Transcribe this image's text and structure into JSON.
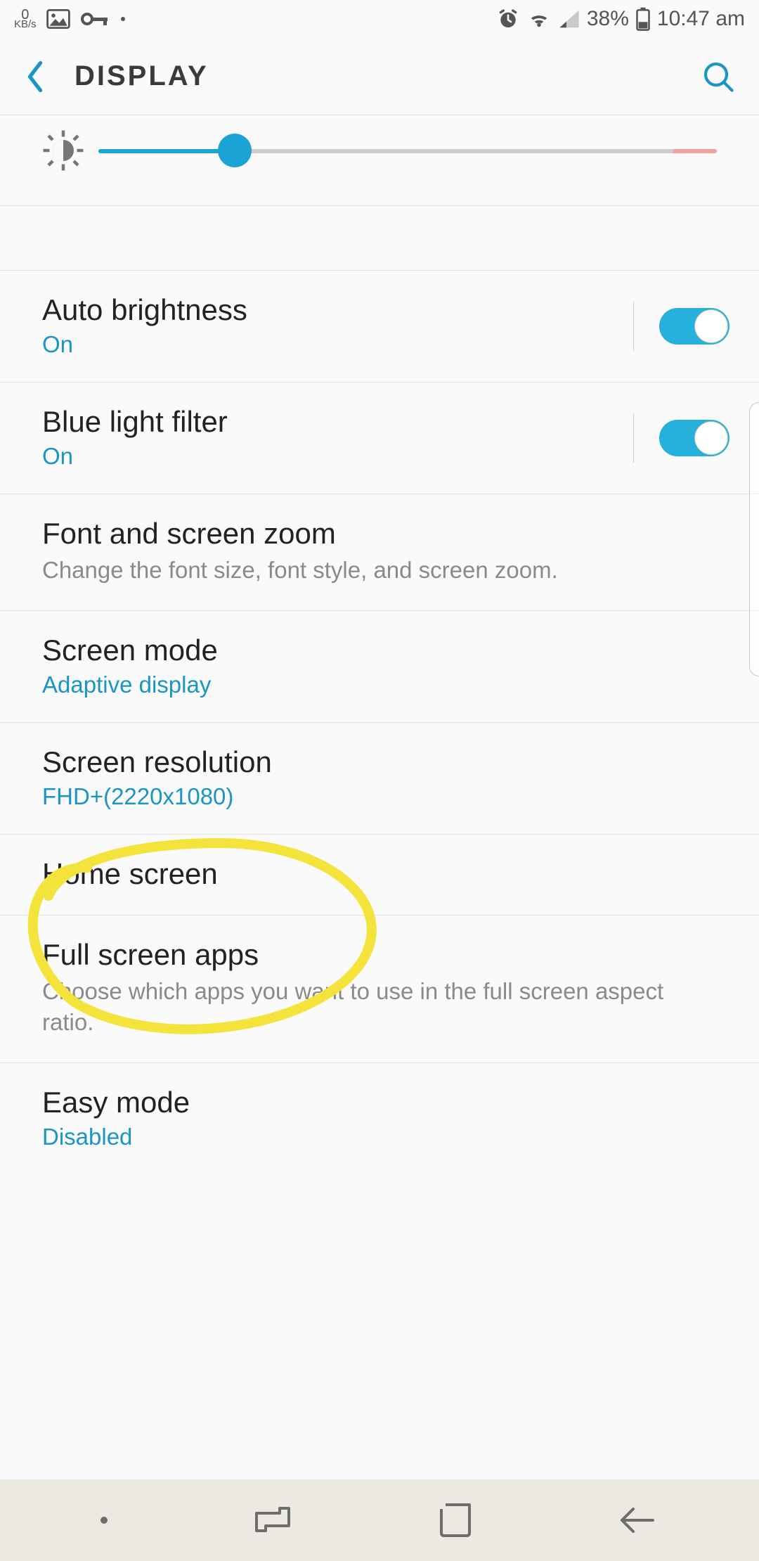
{
  "status": {
    "kbs_value": "0",
    "kbs_unit": "KB/s",
    "battery": "38%",
    "time": "10:47 am"
  },
  "appbar": {
    "title": "DISPLAY"
  },
  "brightness": {
    "percent": 22
  },
  "items": {
    "auto_brightness": {
      "title": "Auto brightness",
      "sub": "On",
      "on": true
    },
    "blue_light": {
      "title": "Blue light filter",
      "sub": "On",
      "on": true
    },
    "font_zoom": {
      "title": "Font and screen zoom",
      "sub": "Change the font size, font style, and screen zoom."
    },
    "screen_mode": {
      "title": "Screen mode",
      "sub": "Adaptive display"
    },
    "screen_resolution": {
      "title": "Screen resolution",
      "sub": "FHD+(2220x1080)"
    },
    "home_screen": {
      "title": "Home screen"
    },
    "full_screen_apps": {
      "title": "Full screen apps",
      "sub": "Choose which apps you want to use in the full screen aspect ratio."
    },
    "easy_mode": {
      "title": "Easy mode",
      "sub": "Disabled"
    }
  }
}
